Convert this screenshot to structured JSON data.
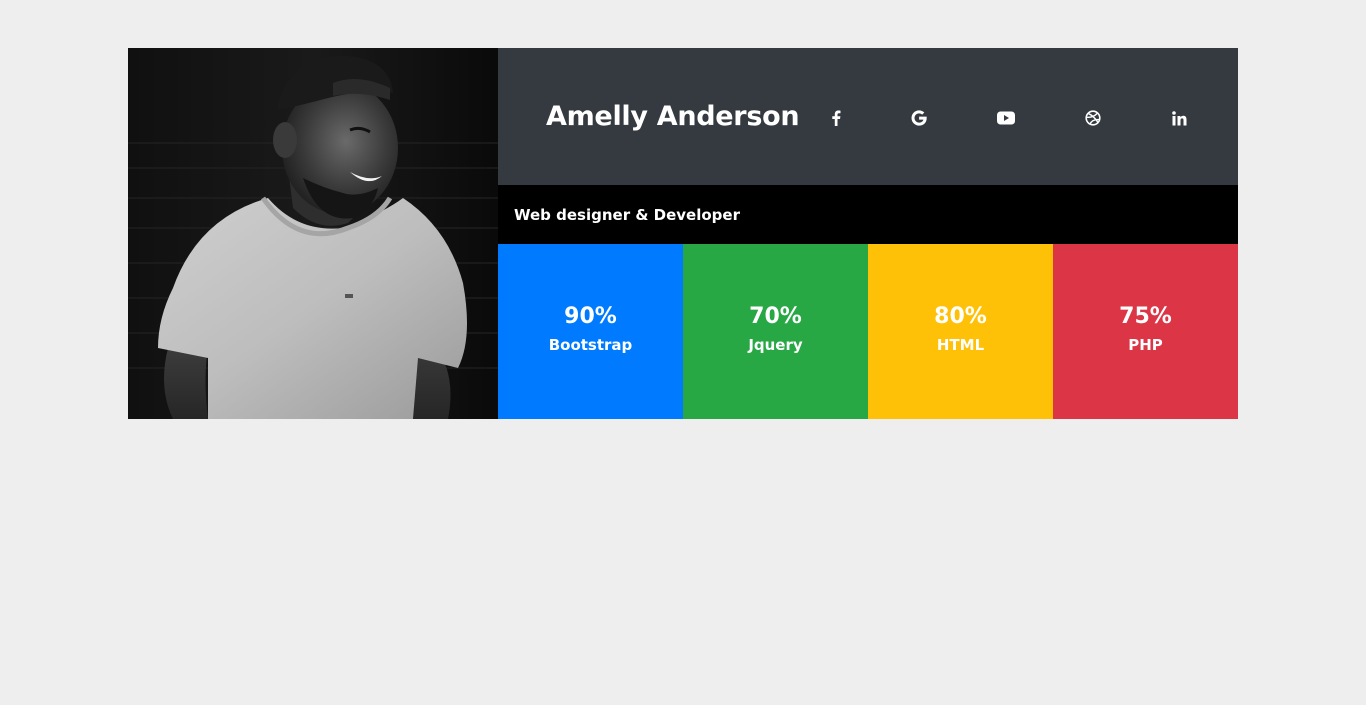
{
  "profile": {
    "photo_alt": "Smiling man in grey t-shirt and backwards cap",
    "name": "Amelly Anderson",
    "tagline": "Web designer & Developer"
  },
  "socials": [
    {
      "icon": "facebook-icon"
    },
    {
      "icon": "google-icon"
    },
    {
      "icon": "youtube-icon"
    },
    {
      "icon": "dribbble-icon"
    },
    {
      "icon": "linkedin-icon"
    }
  ],
  "skills": [
    {
      "percent": "90%",
      "name": "Bootstrap",
      "color": "#007bff"
    },
    {
      "percent": "70%",
      "name": "Jquery",
      "color": "#28a745"
    },
    {
      "percent": "80%",
      "name": "HTML",
      "color": "#ffc107"
    },
    {
      "percent": "75%",
      "name": "PHP",
      "color": "#dc3545"
    }
  ],
  "colors": {
    "page_bg": "#eeeeee",
    "header_bg": "#343a40",
    "tagline_bg": "#000000"
  }
}
